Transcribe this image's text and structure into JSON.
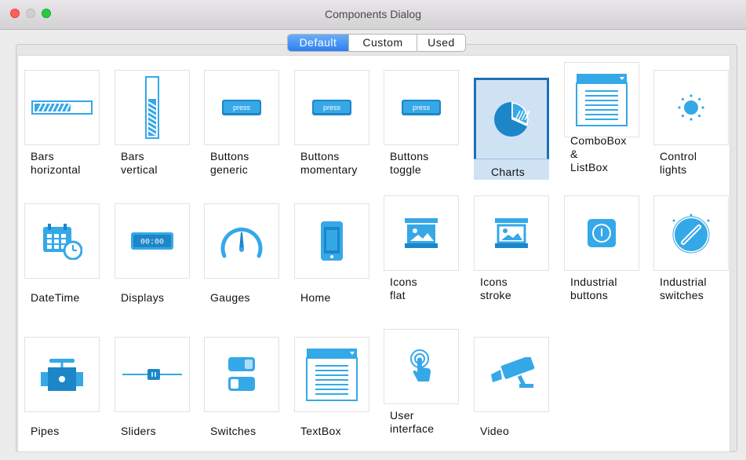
{
  "window": {
    "title": "Components Dialog"
  },
  "tabs": [
    {
      "label": "Default",
      "active": true
    },
    {
      "label": "Custom",
      "active": false
    },
    {
      "label": "Used",
      "active": false
    }
  ],
  "colors": {
    "accent": "#35a8e8",
    "accent_dark": "#1d86c8",
    "selected_bg": "#cfe2f4",
    "selected_border": "#1f6fb5"
  },
  "components": [
    {
      "label": "Bars\nhorizontal",
      "icon": "horizontal-bar-icon"
    },
    {
      "label": "Bars\nvertical",
      "icon": "vertical-bar-icon"
    },
    {
      "label": "Buttons\ngeneric",
      "icon": "press-button-icon",
      "icon_text": "press"
    },
    {
      "label": "Buttons\nmomentary",
      "icon": "press-button-icon",
      "icon_text": "press"
    },
    {
      "label": "Buttons\ntoggle",
      "icon": "press-button-icon",
      "icon_text": "press"
    },
    {
      "label": "Charts",
      "icon": "pie-chart-icon",
      "selected": true
    },
    {
      "label": "ComboBox\n&\nListBox",
      "icon": "combobox-icon"
    },
    {
      "label": "Control\nlights",
      "icon": "light-icon"
    },
    {
      "label": "DateTime",
      "icon": "calendar-clock-icon"
    },
    {
      "label": "Displays",
      "icon": "display-icon",
      "icon_text": "00:00"
    },
    {
      "label": "Gauges",
      "icon": "gauge-icon"
    },
    {
      "label": "Home",
      "icon": "phone-icon"
    },
    {
      "label": "Icons\nflat",
      "icon": "image-flat-icon"
    },
    {
      "label": "Icons\nstroke",
      "icon": "image-stroke-icon"
    },
    {
      "label": "Industrial\nbuttons",
      "icon": "industrial-button-icon"
    },
    {
      "label": "Industrial\nswitches",
      "icon": "industrial-switch-icon"
    },
    {
      "label": "Pipes",
      "icon": "pipe-icon"
    },
    {
      "label": "Sliders",
      "icon": "slider-icon"
    },
    {
      "label": "Switches",
      "icon": "switch-icon"
    },
    {
      "label": "TextBox",
      "icon": "textbox-icon"
    },
    {
      "label": "User\ninterface",
      "icon": "touch-icon"
    },
    {
      "label": "Video",
      "icon": "camera-icon"
    }
  ]
}
